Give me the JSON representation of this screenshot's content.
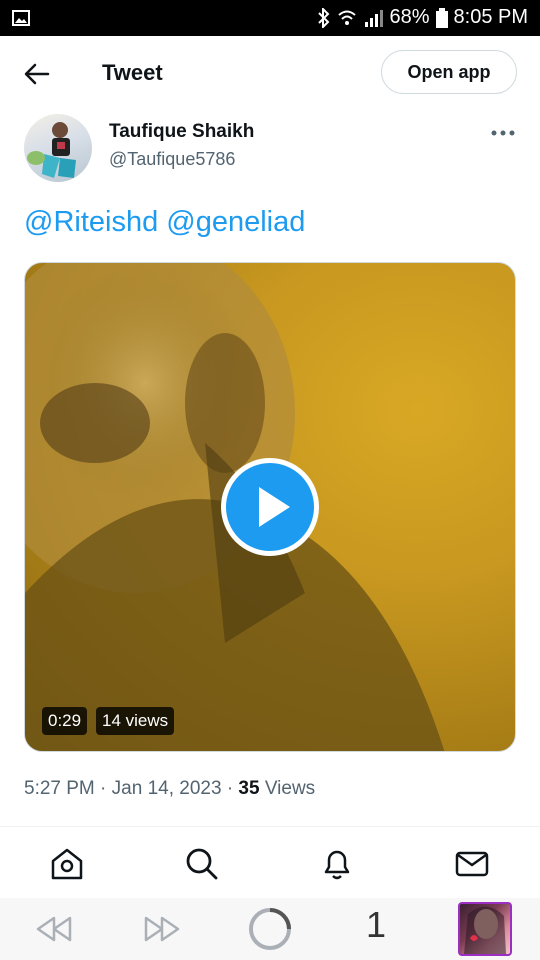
{
  "status_bar": {
    "battery": "68%",
    "time": "8:05 PM",
    "icons": [
      "gallery-icon",
      "bluetooth-icon",
      "wifi-icon",
      "signal-icon",
      "battery-icon"
    ]
  },
  "header": {
    "title": "Tweet",
    "open_app_label": "Open app"
  },
  "tweet": {
    "author_name": "Taufique Shaikh",
    "author_handle": "@Taufique5786",
    "mentions": [
      "@Riteishd",
      "@geneliad"
    ],
    "video": {
      "duration": "0:29",
      "views": "14 views"
    },
    "time": "5:27 PM",
    "date": "Jan 14, 2023",
    "separator": "·",
    "views_count": "35",
    "views_label": "Views"
  },
  "tabbar": {
    "items": [
      "home-icon",
      "search-icon",
      "notifications-icon",
      "messages-icon"
    ]
  },
  "browser_nav": {
    "tab_count": "1"
  },
  "colors": {
    "accent": "#1d9bf0",
    "text_primary": "#0f1419",
    "text_secondary": "#536471"
  }
}
